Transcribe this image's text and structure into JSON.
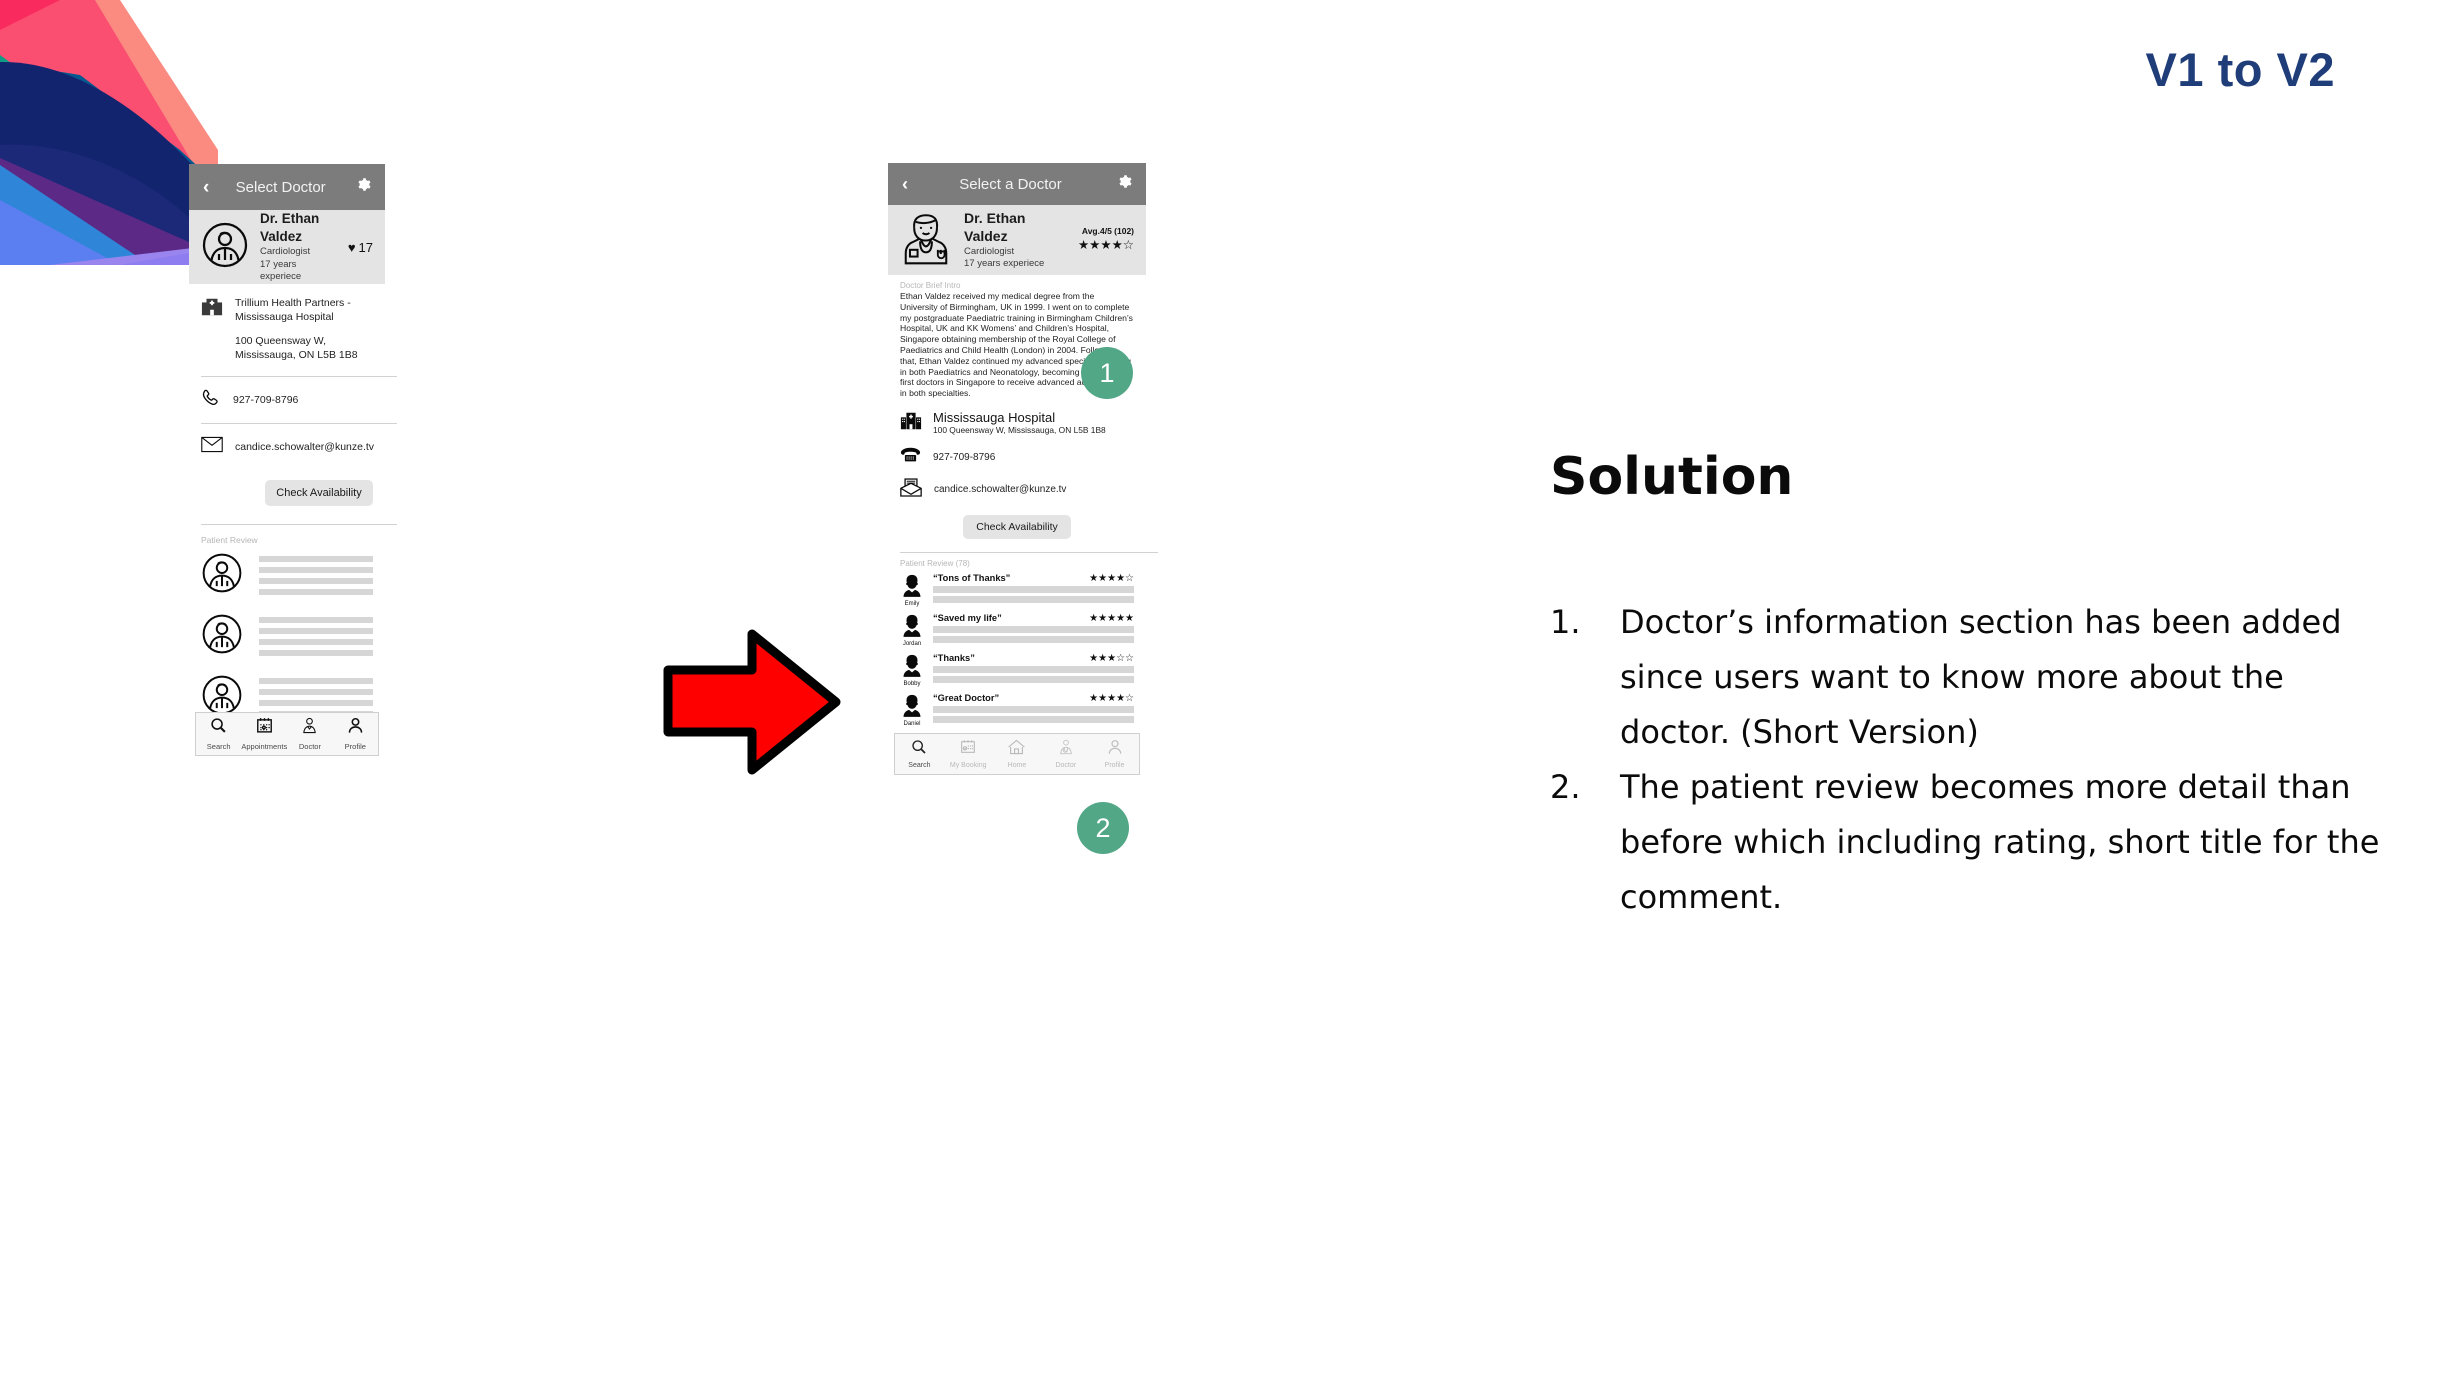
{
  "slide": {
    "corner_label": "V1 to V2",
    "solution_heading": "Solution",
    "solution_points": [
      {
        "num": "1.",
        "text": "Doctor’s information section has been added since users want to know more about the doctor. (Short Version)"
      },
      {
        "num": "2.",
        "text": "The patient review becomes more detail than before which including rating, short title for the comment."
      }
    ],
    "arrow_icon": "right-arrow-icon",
    "accent_blue": "#1f3d78",
    "accent_green": "#52a786",
    "arrow_red": "#ff0000"
  },
  "v1": {
    "appbar": {
      "back_icon": "chevron-left-icon",
      "title": "Select Doctor",
      "settings_icon": "gear-icon"
    },
    "doctor": {
      "avatar_icon": "doctor-avatar-icon",
      "name": "Dr. Ethan Valdez",
      "specialty": "Cardiologist",
      "experience": "17 years experiece",
      "like_icon": "heart-icon",
      "like_count": "17"
    },
    "hospital": {
      "icon": "hospital-icon",
      "name": "Trillium Health Partners - Mississauga Hospital",
      "address": "100 Queensway W, Mississauga, ON L5B 1B8"
    },
    "contact": {
      "phone_icon": "phone-icon",
      "phone": "927-709-8796",
      "email_icon": "envelope-icon",
      "email": "candice.schowalter@kunze.tv"
    },
    "check_availability": "Check Availability",
    "review_label": "Patient Review",
    "reviews_placeholder_count": 3,
    "nav": [
      {
        "icon": "search-icon",
        "label": "Search",
        "active": true
      },
      {
        "icon": "calendar-icon",
        "label": "Appointments",
        "active": false
      },
      {
        "icon": "doctor-icon",
        "label": "Doctor",
        "active": false
      },
      {
        "icon": "person-icon",
        "label": "Profile",
        "active": false
      }
    ]
  },
  "v2": {
    "appbar": {
      "back_icon": "chevron-left-icon",
      "title": "Select a Doctor",
      "settings_icon": "gear-icon"
    },
    "doctor": {
      "avatar_icon": "doctor-portrait-icon",
      "name": "Dr. Ethan Valdez",
      "specialty": "Cardiologist",
      "experience": "17 years experiece",
      "avg_rating": "Avg.4/5 (102)",
      "stars_filled": 4,
      "stars_total": 5
    },
    "intro": {
      "label": "Doctor Brief Intro",
      "text": "Ethan Valdez received my medical degree from the University of Birmingham, UK in 1999. I went on to complete my postgraduate Paediatric training in Birmingham Children’s Hospital, UK and KK Womens’ and Children’s Hospital, Singapore obtaining membership of the Royal College of Paediatrics and Child Health (London) in 2004. Following that, Ethan Valdez continued my advanced specialist training in both Paediatrics and Neonatology, becoming one of the first doctors in Singapore to receive advanced accreditation in both specialties."
    },
    "hospital": {
      "icon": "hospital-icon",
      "name": "Mississauga Hospital",
      "address": "100 Queensway W, Mississauga, ON L5B 1B8"
    },
    "contact": {
      "phone_icon": "telephone-icon",
      "phone": "927-709-8796",
      "email_icon": "open-envelope-icon",
      "email": "candice.schowalter@kunze.tv"
    },
    "check_availability": "Check Availability",
    "review_label": "Patient Review (78)",
    "reviews": [
      {
        "avatar_icon": "reviewer-avatar-icon",
        "name": "Emily",
        "title": "“Tons of Thanks”",
        "stars_filled": 4,
        "stars_total": 5
      },
      {
        "avatar_icon": "reviewer-avatar-icon",
        "name": "Jordan",
        "title": "“Saved my life”",
        "stars_filled": 5,
        "stars_total": 5
      },
      {
        "avatar_icon": "reviewer-avatar-icon",
        "name": "Bobby",
        "title": "“Thanks”",
        "stars_filled": 3,
        "stars_total": 5
      },
      {
        "avatar_icon": "reviewer-avatar-icon",
        "name": "Daniel",
        "title": "“Great Doctor”",
        "stars_filled": 4,
        "stars_total": 5
      }
    ],
    "nav": [
      {
        "icon": "search-icon",
        "label": "Search",
        "active": true
      },
      {
        "icon": "calendar-icon",
        "label": "My Booking",
        "active": false
      },
      {
        "icon": "home-icon",
        "label": "Home",
        "active": false
      },
      {
        "icon": "doctor-icon",
        "label": "Doctor",
        "active": false
      },
      {
        "icon": "person-icon",
        "label": "Profile",
        "active": false
      }
    ],
    "badges": [
      {
        "num": "1"
      },
      {
        "num": "2"
      }
    ]
  }
}
